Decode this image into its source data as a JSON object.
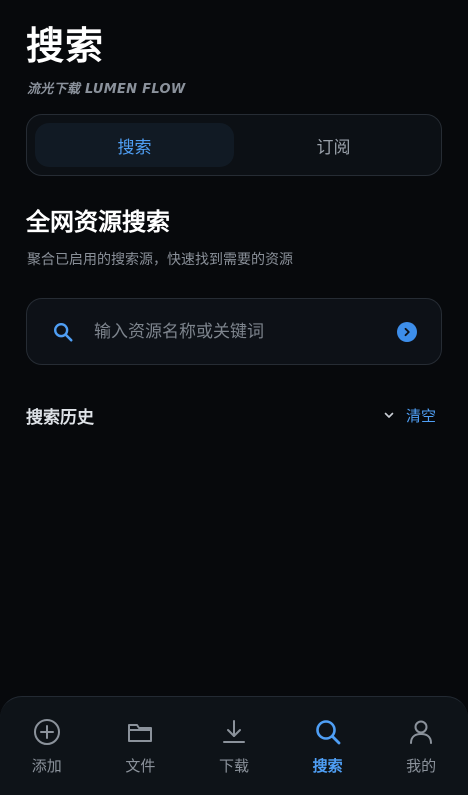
{
  "header": {
    "title": "搜索",
    "subtitle": "流光下载 LUMEN FLOW"
  },
  "segments": [
    {
      "label": "搜索",
      "active": true
    },
    {
      "label": "订阅",
      "active": false
    }
  ],
  "section": {
    "title": "全网资源搜索",
    "description": "聚合已启用的搜索源，快速找到需要的资源"
  },
  "search": {
    "placeholder": "输入资源名称或关键词",
    "value": "",
    "lead_icon": "search-icon",
    "submit_icon": "chevron-right-circle-icon"
  },
  "history": {
    "title": "搜索历史",
    "toggle_icon": "chevron-down-icon",
    "clear_label": "清空"
  },
  "tabbar": {
    "items": [
      {
        "label": "添加",
        "icon": "plus-circle-icon",
        "active": false
      },
      {
        "label": "文件",
        "icon": "folder-icon",
        "active": false
      },
      {
        "label": "下载",
        "icon": "download-icon",
        "active": false
      },
      {
        "label": "搜索",
        "icon": "search-icon",
        "active": true
      },
      {
        "label": "我的",
        "icon": "user-icon",
        "active": false
      }
    ]
  },
  "colors": {
    "background": "#07090c",
    "accent": "#4f9ff5",
    "muted_text": "#8b929c",
    "card_border": "#262c34"
  }
}
